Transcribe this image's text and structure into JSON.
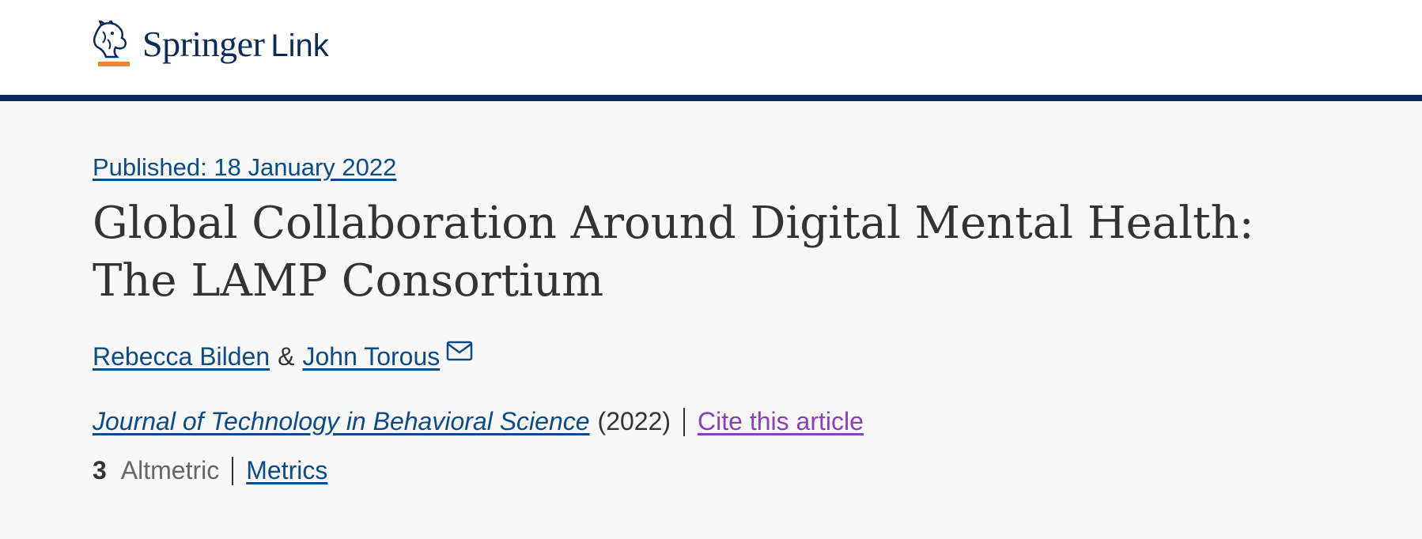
{
  "header": {
    "brand": "Springer",
    "product": "Link"
  },
  "article": {
    "published": "Published: 18 January 2022",
    "title": "Global Collaboration Around Digital Mental Health: The LAMP Consortium",
    "authors": [
      "Rebecca Bilden",
      "John Torous"
    ],
    "author_separator": "&",
    "journal": "Journal of Technology in Behavioral Science",
    "year": "(2022)",
    "cite_label": "Cite this article",
    "altmetric_count": "3",
    "altmetric_label": "Altmetric",
    "metrics_label": "Metrics"
  },
  "colors": {
    "header_bar": "#0b2a59",
    "link": "#0b4b88",
    "cite_link": "#8a3fb8",
    "logo_accent": "#e58a2e"
  },
  "icons": [
    "springer-horse-logo-icon",
    "mail-icon"
  ]
}
